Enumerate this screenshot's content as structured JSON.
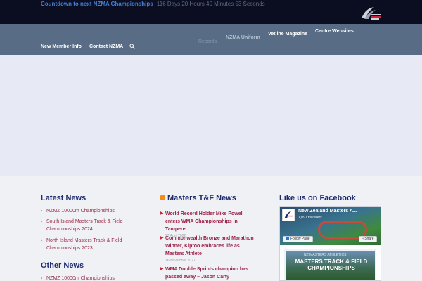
{
  "countdown": {
    "label": "Countdown to next NZMA Championships",
    "value": "116 Days 20 Hours 40 Minutes 53 Seconds"
  },
  "logo": {
    "alt_icon": "nz-masters-athletics-logo-icon"
  },
  "nav": {
    "records": "Records",
    "uniform": "NZMA Uniform",
    "vetline": "Vetline Magazine",
    "centres": "Centre Websites",
    "new_member": "New Member Info",
    "contact": "Contact NZMA",
    "search_icon": "search-icon"
  },
  "latest_news": {
    "title": "Latest News",
    "items": [
      "NZMZ 10000m Championships",
      "South Island Masters Track & Field Championships 2024",
      "North Island Masters Track & Field Championships 2023"
    ]
  },
  "other_news": {
    "title": "Other News",
    "items": [
      "NZMZ 10000m Championships"
    ]
  },
  "masters_news": {
    "title": "Masters T&F News",
    "items": [
      {
        "title": "World Record Holder Mike Powell enters WMA Championships in Tampere",
        "date": "27 April 2022"
      },
      {
        "title": "Commonwealth Bronze and Marathon Winner, Kiptoo embraces life as Masters Athlete",
        "date": "16 November 2021"
      },
      {
        "title": "WMA Double Sprints champion has passed away – Jason Carty",
        "date": ""
      }
    ]
  },
  "facebook": {
    "title": "Like us on Facebook",
    "page_name": "New Zealand Masters A...",
    "followers": "1,091 followers",
    "follow_label": "Follow Page",
    "share_label": "Share",
    "post_tag": "NZ MASTERS ATHLETICS",
    "post_title": "MASTERS TRACK & FIELD CHAMPIONSHIPS"
  },
  "colors": {
    "topbar": "#0b0d20",
    "nav": "#586c85",
    "heading": "#1f2b6f",
    "link": "#9b2a4a",
    "countdown_label": "#3f7fd8"
  }
}
